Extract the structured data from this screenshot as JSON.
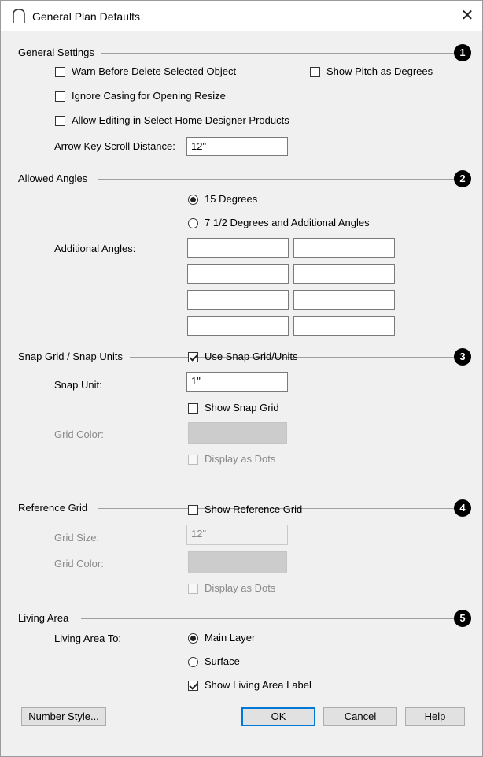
{
  "window": {
    "title": "General Plan Defaults",
    "close_glyph": "✕"
  },
  "sections": {
    "general": {
      "title": "General Settings",
      "number": "1",
      "warn_delete": {
        "label": "Warn Before Delete Selected Object",
        "checked": false
      },
      "show_pitch": {
        "label": "Show Pitch as Degrees",
        "checked": false
      },
      "ignore_casing": {
        "label": "Ignore Casing for Opening Resize",
        "checked": false
      },
      "allow_editing": {
        "label": "Allow Editing in Select Home Designer Products",
        "checked": false
      },
      "arrow_key_label": "Arrow Key Scroll Distance:",
      "arrow_key_value": "12\""
    },
    "angles": {
      "title": "Allowed Angles",
      "number": "2",
      "option_15": {
        "label": "15 Degrees",
        "selected": true
      },
      "option_7": {
        "label": "7 1/2 Degrees and Additional Angles",
        "selected": false
      },
      "additional_label": "Additional Angles:",
      "additional_values": [
        "",
        "",
        "",
        "",
        "",
        "",
        "",
        ""
      ]
    },
    "snap": {
      "title": "Snap Grid / Snap Units",
      "number": "3",
      "use_snap": {
        "label": "Use Snap Grid/Units",
        "checked": true
      },
      "snap_unit_label": "Snap Unit:",
      "snap_unit_value": "1\"",
      "show_snap_grid": {
        "label": "Show Snap Grid",
        "checked": false
      },
      "grid_color_label": "Grid Color:",
      "grid_color": "#cccccc",
      "display_dots": {
        "label": "Display as Dots",
        "checked": false,
        "disabled": true
      }
    },
    "reference": {
      "title": "Reference Grid",
      "number": "4",
      "show_ref_grid": {
        "label": "Show Reference Grid",
        "checked": false
      },
      "grid_size_label": "Grid Size:",
      "grid_size_value": "12\"",
      "grid_color_label": "Grid Color:",
      "grid_color": "#cccccc",
      "display_dots": {
        "label": "Display as Dots",
        "checked": false,
        "disabled": true
      }
    },
    "living": {
      "title": "Living Area",
      "number": "5",
      "living_to_label": "Living Area To:",
      "main_layer": {
        "label": "Main Layer",
        "selected": true
      },
      "surface": {
        "label": "Surface",
        "selected": false
      },
      "show_label": {
        "label": "Show Living Area Label",
        "checked": true
      }
    }
  },
  "buttons": {
    "number_style": "Number Style...",
    "ok": "OK",
    "cancel": "Cancel",
    "help": "Help"
  },
  "colors": {
    "accent": "#0078d7",
    "disabled_text": "#8a8a8a"
  }
}
